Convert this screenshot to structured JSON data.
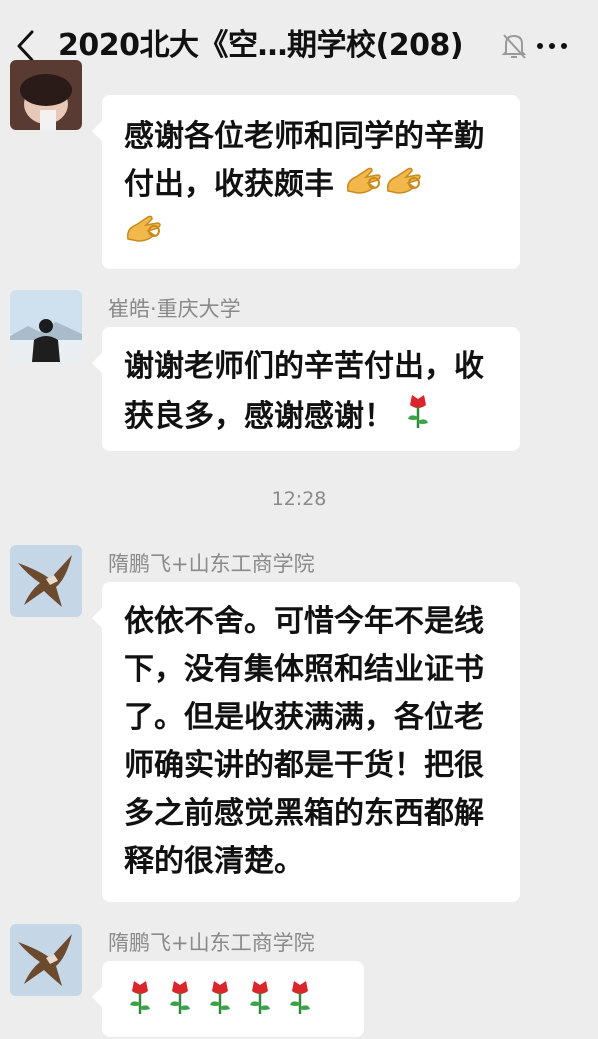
{
  "header": {
    "title": "2020北大《空…期学校(208)",
    "back_icon": "chevron-left-icon",
    "mute_icon": "bell-muted-icon",
    "more_icon": "ellipsis-icon"
  },
  "messages": [
    {
      "sender": "",
      "text": "感谢各位老师和同学的辛勤付出，收获颇丰",
      "emoji": [
        "ok-hand-emoji",
        "ok-hand-emoji",
        "ok-hand-emoji"
      ]
    },
    {
      "sender": "崔皓·重庆大学",
      "text": "谢谢老师们的辛苦付出，收获良多，感谢感谢！",
      "emoji": [
        "rose-emoji"
      ]
    },
    {
      "sender": "隋鹏飞+山东工商学院",
      "text": "依依不舍。可惜今年不是线下，没有集体照和结业证书了。但是收获满满，各位老师确实讲的都是干货！把很多之前感觉黑箱的东西都解释的很清楚。",
      "emoji": []
    },
    {
      "sender": "隋鹏飞+山东工商学院",
      "text": "",
      "emoji": [
        "rose-emoji",
        "rose-emoji",
        "rose-emoji",
        "rose-emoji",
        "rose-emoji"
      ]
    }
  ],
  "timestamp": "12:28",
  "colors": {
    "background": "#ededed",
    "bubble": "#ffffff",
    "meta_text": "#8a8a8a"
  }
}
